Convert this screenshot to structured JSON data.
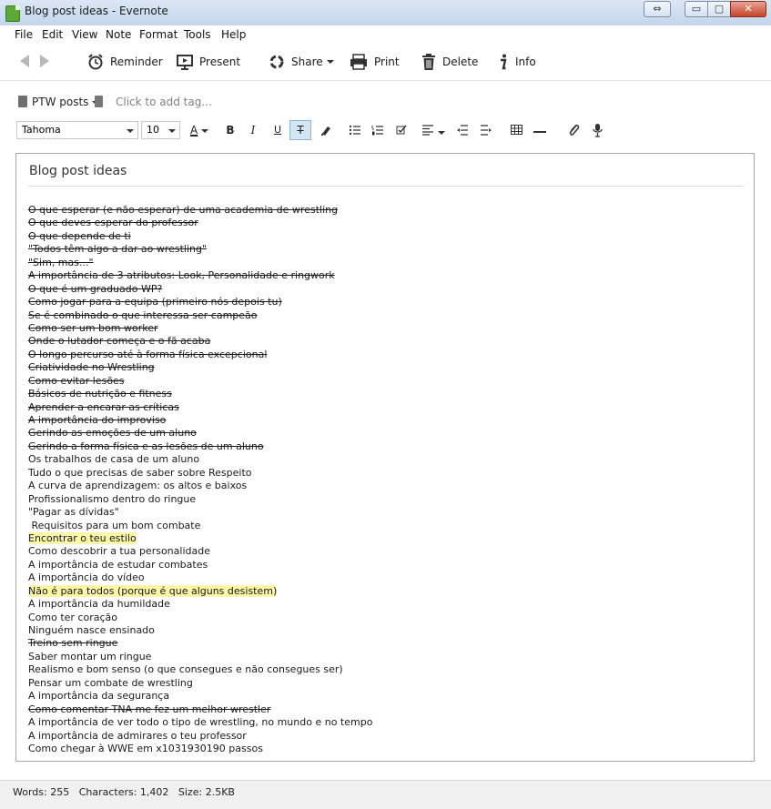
{
  "window": {
    "title": "Blog post ideas - Evernote",
    "controls": {
      "restore": "⇔",
      "minimize": "▭",
      "maximize": "▢",
      "close": "✕"
    }
  },
  "menu": [
    "File",
    "Edit",
    "View",
    "Note",
    "Format",
    "Tools",
    "Help"
  ],
  "toolbar": {
    "reminder": "Reminder",
    "present": "Present",
    "share": "Share",
    "print": "Print",
    "delete": "Delete",
    "info": "Info"
  },
  "notebook": {
    "name": "PTW posts",
    "tag_placeholder": "Click to add tag..."
  },
  "format": {
    "font": "Tahoma",
    "size": "10",
    "buttons": {
      "text_color": "A",
      "bold": "B",
      "italic": "I",
      "underline": "U",
      "strikethrough": "T"
    }
  },
  "note": {
    "title": "Blog post ideas",
    "lines": [
      {
        "text": "O que esperar (e não esperar) de uma academia de wrestling",
        "struck": true,
        "highlight": false
      },
      {
        "text": "O que deves esperar do professor",
        "struck": true,
        "highlight": false
      },
      {
        "text": "O que depende de ti",
        "struck": true,
        "highlight": false
      },
      {
        "text": "\"Todos têm algo a dar ao wrestling\"",
        "struck": true,
        "highlight": false
      },
      {
        "text": "\"Sim, mas...\"",
        "struck": true,
        "highlight": false
      },
      {
        "text": "A importância de 3 atributos: Look, Personalidade e ringwork",
        "struck": true,
        "highlight": false
      },
      {
        "text": "O que é um graduado WP?",
        "struck": true,
        "highlight": false
      },
      {
        "text": "Como jogar para a equipa (primeiro nós depois tu)",
        "struck": true,
        "highlight": false
      },
      {
        "text": "Se é combinado o que interessa ser campeão",
        "struck": true,
        "highlight": false
      },
      {
        "text": "Como ser um bom worker",
        "struck": true,
        "highlight": false
      },
      {
        "text": "Onde o lutador começa e o fã acaba",
        "struck": true,
        "highlight": false
      },
      {
        "text": "O longo percurso até à forma física excepcional",
        "struck": true,
        "highlight": false
      },
      {
        "text": "Criatividade no Wrestling",
        "struck": true,
        "highlight": false
      },
      {
        "text": "Como evitar lesões",
        "struck": true,
        "highlight": false
      },
      {
        "text": "Básicos de nutrição e fitness",
        "struck": true,
        "highlight": false
      },
      {
        "text": "Aprender a encarar as críticas",
        "struck": true,
        "highlight": false
      },
      {
        "text": "A importância do improviso",
        "struck": true,
        "highlight": false
      },
      {
        "text": "Gerindo as emoções de um aluno",
        "struck": true,
        "highlight": false
      },
      {
        "text": "Gerindo a forma física e as lesões de um aluno",
        "struck": true,
        "highlight": false
      },
      {
        "text": "Os trabalhos de casa de um aluno",
        "struck": false,
        "highlight": false
      },
      {
        "text": "Tudo o que precisas de saber sobre Respeito",
        "struck": false,
        "highlight": false
      },
      {
        "text": "A curva de aprendizagem: os altos e baixos",
        "struck": false,
        "highlight": false
      },
      {
        "text": "Profissionalismo dentro do ringue",
        "struck": false,
        "highlight": false
      },
      {
        "text": "\"Pagar as dívidas\"",
        "struck": false,
        "highlight": false
      },
      {
        "text": " Requisitos para um bom combate",
        "struck": false,
        "highlight": false
      },
      {
        "text": "Encontrar o teu estilo",
        "struck": false,
        "highlight": true
      },
      {
        "text": "Como descobrir a tua personalidade",
        "struck": false,
        "highlight": false
      },
      {
        "text": "A importância de estudar combates",
        "struck": false,
        "highlight": false
      },
      {
        "text": "A importância do vídeo",
        "struck": false,
        "highlight": false
      },
      {
        "text": "Não é para todos (porque é que alguns desistem)",
        "struck": false,
        "highlight": true
      },
      {
        "text": "A importância da humildade",
        "struck": false,
        "highlight": false
      },
      {
        "text": "Como ter coração",
        "struck": false,
        "highlight": false
      },
      {
        "text": "Ninguém nasce ensinado",
        "struck": false,
        "highlight": false
      },
      {
        "text": "Treino sem ringue",
        "struck": true,
        "highlight": false
      },
      {
        "text": "Saber montar um ringue",
        "struck": false,
        "highlight": false
      },
      {
        "text": "Realismo e bom senso (o que consegues e não consegues ser)",
        "struck": false,
        "highlight": false
      },
      {
        "text": "Pensar um combate de wrestling",
        "struck": false,
        "highlight": false
      },
      {
        "text": "A importância da segurança",
        "struck": false,
        "highlight": false
      },
      {
        "text": "Como comentar TNA me fez um melhor wrestler",
        "struck": true,
        "highlight": false
      },
      {
        "text": "A importância de ver todo o tipo de wrestling, no mundo e no tempo",
        "struck": false,
        "highlight": false
      },
      {
        "text": "A importância de admirares o teu professor",
        "struck": false,
        "highlight": false
      },
      {
        "text": "Como chegar à WWE em x1031930190 passos",
        "struck": false,
        "highlight": false
      }
    ]
  },
  "status": "Words: 255   Characters: 1,402   Size: 2.5KB"
}
